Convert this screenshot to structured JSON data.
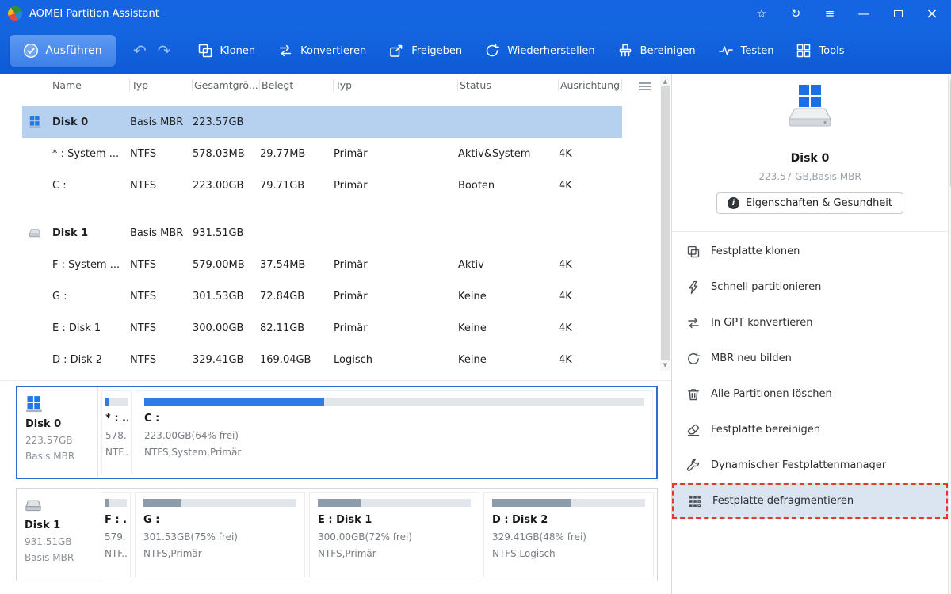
{
  "window": {
    "title": "AOMEI Partition Assistant",
    "controls": {
      "favorite_glyph": "☆",
      "refresh_glyph": "↻",
      "menu_glyph": "≡",
      "minimize_glyph": "—",
      "close_glyph": "×"
    }
  },
  "toolbar": {
    "apply_label": "Ausführen",
    "undo_glyph": "↶",
    "redo_glyph": "↷",
    "items": [
      {
        "label": "Klonen",
        "icon": "clone-toolbar-icon"
      },
      {
        "label": "Konvertieren",
        "icon": "convert-toolbar-icon"
      },
      {
        "label": "Freigeben",
        "icon": "share-toolbar-icon"
      },
      {
        "label": "Wiederherstellen",
        "icon": "restore-toolbar-icon"
      },
      {
        "label": "Bereinigen",
        "icon": "clean-toolbar-icon"
      },
      {
        "label": "Testen",
        "icon": "test-toolbar-icon"
      },
      {
        "label": "Tools",
        "icon": "tools-toolbar-icon"
      }
    ]
  },
  "table": {
    "columns": [
      "Name",
      "Typ",
      "Gesamtgrö...",
      "Belegt",
      "Typ",
      "Status",
      "Ausrichtung"
    ],
    "scroll_up_glyph": "▲",
    "scroll_down_glyph": "▼",
    "rows": [
      {
        "kind": "disk",
        "selected": true,
        "icon": "disk0-icon",
        "cells": [
          "Disk 0",
          "Basis MBR",
          "223.57GB",
          "",
          "",
          "",
          ""
        ]
      },
      {
        "kind": "partition",
        "cells": [
          "* : System ...",
          "NTFS",
          "578.03MB",
          "29.77MB",
          "Primär",
          "Aktiv&System",
          "4K"
        ]
      },
      {
        "kind": "partition",
        "cells": [
          "C :",
          "NTFS",
          "223.00GB",
          "79.71GB",
          "Primär",
          "Booten",
          "4K"
        ]
      },
      {
        "kind": "disk",
        "gap_before": true,
        "icon": "disk1-icon",
        "cells": [
          "Disk 1",
          "Basis MBR",
          "931.51GB",
          "",
          "",
          "",
          ""
        ]
      },
      {
        "kind": "partition",
        "cells": [
          "F : System ...",
          "NTFS",
          "579.00MB",
          "37.54MB",
          "Primär",
          "Aktiv",
          "4K"
        ]
      },
      {
        "kind": "partition",
        "cells": [
          "G :",
          "NTFS",
          "301.53GB",
          "72.84GB",
          "Primär",
          "Keine",
          "4K"
        ]
      },
      {
        "kind": "partition",
        "cells": [
          "E : Disk 1",
          "NTFS",
          "300.00GB",
          "82.11GB",
          "Primär",
          "Keine",
          "4K"
        ]
      },
      {
        "kind": "partition",
        "cells": [
          "D : Disk 2",
          "NTFS",
          "329.41GB",
          "169.04GB",
          "Logisch",
          "Keine",
          "4K"
        ]
      }
    ]
  },
  "disk_panels": [
    {
      "selected": true,
      "disk": {
        "name": "Disk 0",
        "size": "223.57GB",
        "type": "Basis MBR",
        "icon": "disk0-icon"
      },
      "partitions": [
        {
          "small": true,
          "line1": "* : ...",
          "line2": "578...",
          "line3": "NTF...",
          "used_pct": 18,
          "fill": "blue"
        },
        {
          "small": false,
          "line1": "C :",
          "line2": "223.00GB(64% frei)",
          "line3": "NTFS,System,Primär",
          "used_pct": 36,
          "fill": "blue"
        }
      ]
    },
    {
      "selected": false,
      "disk": {
        "name": "Disk 1",
        "size": "931.51GB",
        "type": "Basis MBR",
        "icon": "disk1-icon"
      },
      "partitions": [
        {
          "small": true,
          "line1": "F : ...",
          "line2": "579...",
          "line3": "NTF...",
          "used_pct": 18,
          "fill": "gray"
        },
        {
          "small": false,
          "line1": "G :",
          "line2": "301.53GB(75% frei)",
          "line3": "NTFS,Primär",
          "used_pct": 25,
          "fill": "gray"
        },
        {
          "small": false,
          "line1": "E : Disk 1",
          "line2": "300.00GB(72% frei)",
          "line3": "NTFS,Primär",
          "used_pct": 28,
          "fill": "gray"
        },
        {
          "small": false,
          "line1": "D : Disk 2",
          "line2": "329.41GB(48% frei)",
          "line3": "NTFS,Logisch",
          "used_pct": 52,
          "fill": "gray"
        }
      ]
    }
  ],
  "sidebar": {
    "disk_title": "Disk 0",
    "disk_subtitle": "223.57 GB,Basis MBR",
    "properties_button": "Eigenschaften & Gesundheit",
    "info_glyph": "i",
    "menu": [
      {
        "label": "Festplatte klonen",
        "icon": "clone-icon"
      },
      {
        "label": "Schnell partitionieren",
        "icon": "lightning-icon"
      },
      {
        "label": "In GPT konvertieren",
        "icon": "convert-icon"
      },
      {
        "label": "MBR neu bilden",
        "icon": "rebuild-icon"
      },
      {
        "label": "Alle Partitionen löschen",
        "icon": "trash-icon"
      },
      {
        "label": "Festplatte bereinigen",
        "icon": "wipe-icon"
      },
      {
        "label": "Dynamischer Festplattenmanager",
        "icon": "wrench-icon"
      },
      {
        "label": "Festplatte defragmentieren",
        "icon": "defrag-icon",
        "highlighted": true
      }
    ]
  },
  "colors": {
    "titlebar": "#1565e2",
    "toolbar_top": "#1566e1",
    "toolbar_bottom": "#0f5ad6",
    "apply_top": "#5e9af1",
    "apply_bottom": "#3c80ea",
    "selected_row": "#b5d1ef",
    "bar_blue": "#2e7ce5",
    "bar_gray": "#8d9cab",
    "bar_track": "#e2e6ea",
    "panel_selected_border": "#2a6fce",
    "highlight_bg": "#dbe5f1",
    "highlight_border": "#e23b2e"
  }
}
